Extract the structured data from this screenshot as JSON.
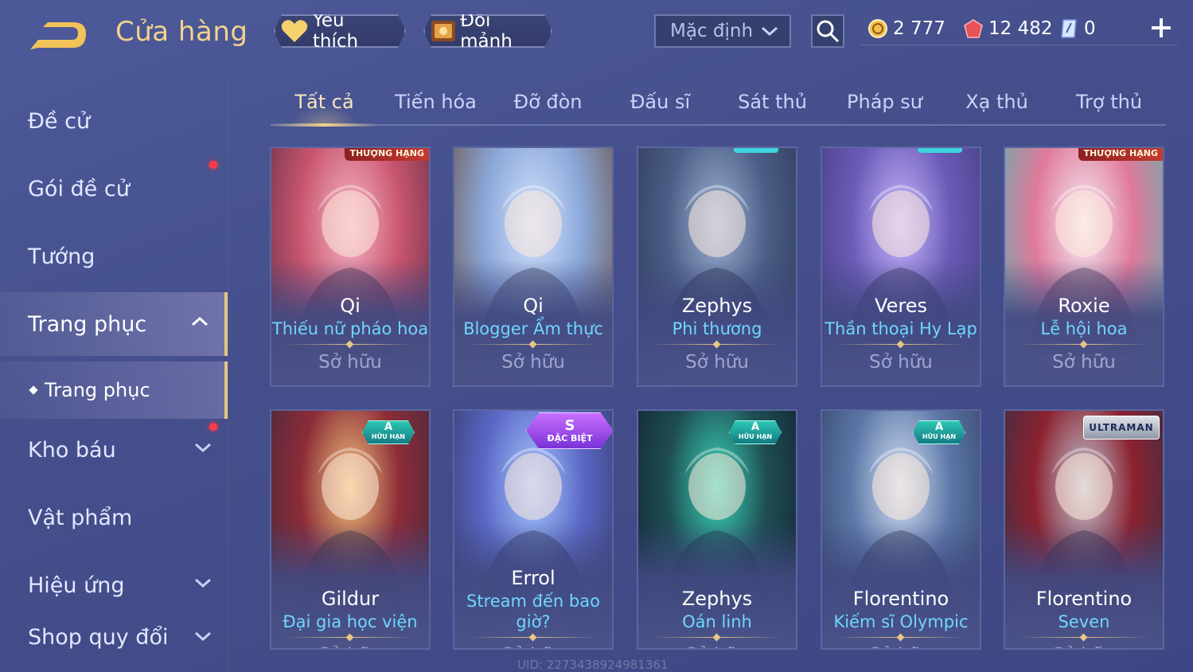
{
  "header": {
    "title": "Cửa hàng",
    "favorite_label": "Yêu thích",
    "fragment_label": "Đổi mảnh",
    "sort_label": "Mặc định",
    "currencies": [
      {
        "name": "gold",
        "value": "2 777",
        "color": "#f3c04d"
      },
      {
        "name": "voucher",
        "value": "12 482",
        "color": "#e8525a"
      },
      {
        "name": "gem",
        "value": "0",
        "color": "#9db8ff"
      }
    ]
  },
  "sidebar": {
    "items": [
      {
        "label": "Đề cử"
      },
      {
        "label": "Gói đề cử",
        "badge": true
      },
      {
        "label": "Tướng"
      },
      {
        "label": "Trang phục",
        "active": true,
        "expanded": true
      },
      {
        "label": "Trang phục",
        "sub": true
      },
      {
        "label": "Kho báu",
        "badge": true,
        "chevron": "down"
      },
      {
        "label": "Vật phẩm"
      },
      {
        "label": "Hiệu ứng",
        "chevron": "down"
      },
      {
        "label": "Shop quy đổi",
        "chevron": "down"
      }
    ]
  },
  "tabs": [
    {
      "label": "Tất cả",
      "active": true
    },
    {
      "label": "Tiến hóa"
    },
    {
      "label": "Đỡ đòn"
    },
    {
      "label": "Đấu sĩ"
    },
    {
      "label": "Sát thủ"
    },
    {
      "label": "Pháp sư"
    },
    {
      "label": "Xạ thủ"
    },
    {
      "label": "Trợ thủ"
    }
  ],
  "cards": [
    {
      "hero": "Qi",
      "skin": "Thiếu nữ pháo hoa",
      "status": "Sở hữu",
      "badge": "THƯỢNG HẠNG",
      "art": [
        "#f7b7c9",
        "#c9566f",
        "#5a2a46"
      ]
    },
    {
      "hero": "Qi",
      "skin": "Blogger Ẩm thực",
      "status": "Sở hữu",
      "art": [
        "#d5e3ff",
        "#8aa7d8",
        "#6a4b3a"
      ]
    },
    {
      "hero": "Zephys",
      "skin": "Phi thương",
      "status": "Sở hữu",
      "art": [
        "#9fb4d6",
        "#4b5e86",
        "#2a3551"
      ]
    },
    {
      "hero": "Veres",
      "skin": "Thần thoại Hy Lạp",
      "status": "Sở hữu",
      "art": [
        "#c9b8ff",
        "#6b5bb8",
        "#3d3a78"
      ]
    },
    {
      "hero": "Roxie",
      "skin": "Lễ hội hoa",
      "status": "Sở hữu",
      "badge": "THƯỢNG HẠNG",
      "art": [
        "#f4eef7",
        "#e07a9a",
        "#4fb6b3"
      ]
    },
    {
      "hero": "Gildur",
      "skin": "Đại gia học viện",
      "status": "Sở hữu",
      "tier": "A",
      "tier_sub": "HỮU HẠN",
      "art": [
        "#f0c27a",
        "#8c2b38",
        "#3a2a3e"
      ]
    },
    {
      "hero": "Errol",
      "skin": "Stream đến bao giờ?",
      "status": "Sở hữu",
      "tier_s": "S",
      "tier_s_sub": "ĐẶC BIỆT",
      "art": [
        "#a6c7ff",
        "#5b68c6",
        "#2f3460"
      ]
    },
    {
      "hero": "Zephys",
      "skin": "Oán linh",
      "status": "Sở hữu",
      "tier": "A",
      "tier_sub": "HỮU HẠN",
      "art": [
        "#3bd6b8",
        "#1e4d52",
        "#121c2c"
      ]
    },
    {
      "hero": "Florentino",
      "skin": "Kiếm sĩ Olympic",
      "status": "Sở hữu",
      "tier": "A",
      "tier_sub": "HỮU HẠN",
      "art": [
        "#d4dff2",
        "#5c78a8",
        "#2f3c5f"
      ]
    },
    {
      "hero": "Florentino",
      "skin": "Seven",
      "status": "Sở hữu",
      "ultra": "ULTRAMAN",
      "art": [
        "#c0c8d6",
        "#8b2230",
        "#2a3148"
      ]
    }
  ],
  "footer": {
    "uid": "UID: 2273438924981361"
  }
}
